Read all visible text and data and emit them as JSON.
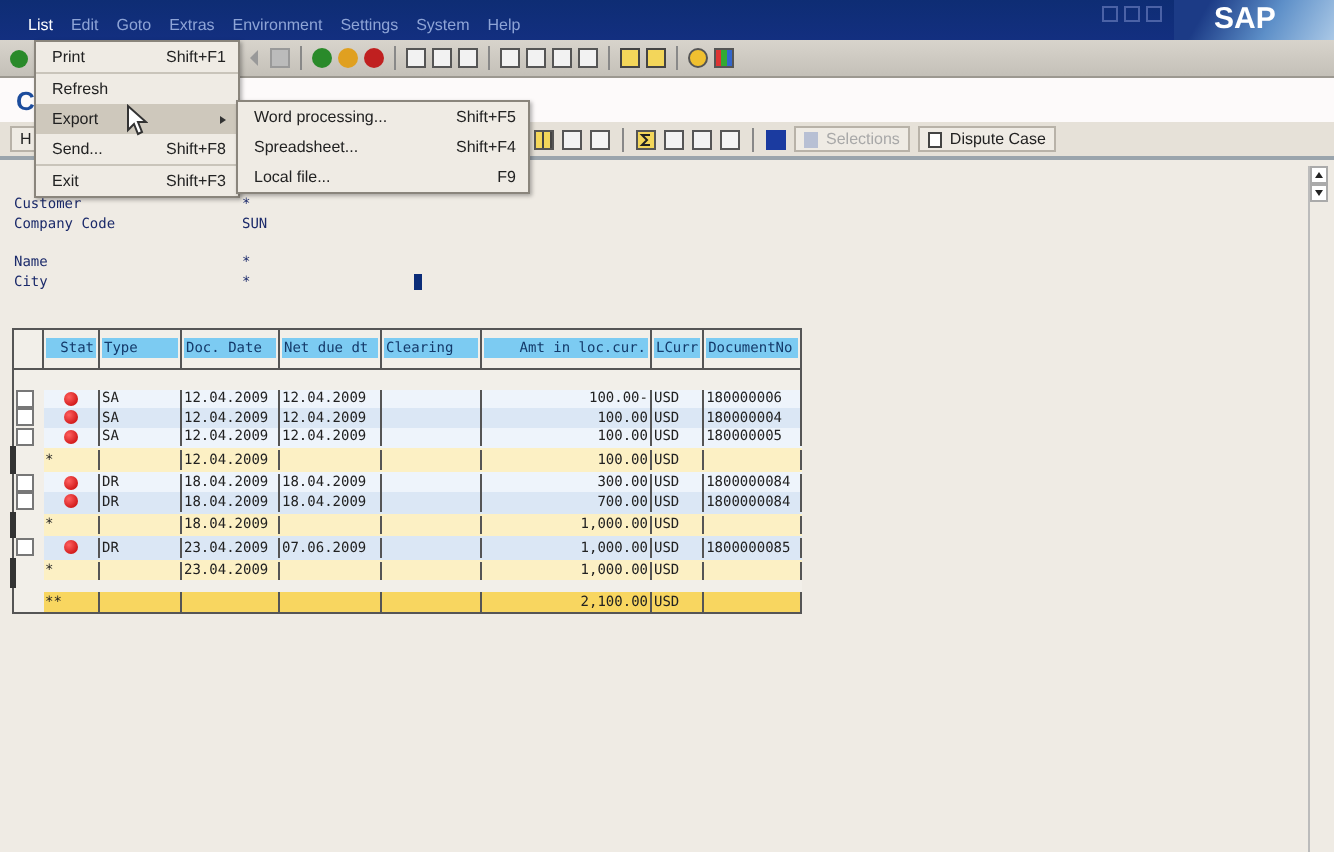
{
  "menubar": [
    {
      "label": "List",
      "selected": true
    },
    {
      "label": "Edit",
      "selected": false
    },
    {
      "label": "Goto",
      "selected": false
    },
    {
      "label": "Extras",
      "selected": false
    },
    {
      "label": "Environment",
      "selected": false
    },
    {
      "label": "Settings",
      "selected": false
    },
    {
      "label": "System",
      "selected": false
    },
    {
      "label": "Help",
      "selected": false
    }
  ],
  "logo": "SAP",
  "title": "C",
  "app_toolbar": {
    "left": "H",
    "buttons": [
      {
        "label": "Selections",
        "disabled": true
      },
      {
        "label": "Dispute Case",
        "disabled": false
      }
    ]
  },
  "list_menu": [
    {
      "label": "Print",
      "shortcut": "Shift+F1",
      "selected": false,
      "submenu": false
    },
    {
      "label": "Refresh",
      "selected": false,
      "submenu": false
    },
    {
      "label": "Export",
      "selected": true,
      "submenu": true
    },
    {
      "label": "Send...",
      "shortcut": "Shift+F8",
      "selected": false,
      "submenu": false
    },
    {
      "label": "Exit",
      "shortcut": "Shift+F3",
      "selected": false,
      "submenu": false
    }
  ],
  "export_menu": [
    {
      "label": "Word processing...",
      "shortcut": "Shift+F5"
    },
    {
      "label": "Spreadsheet...",
      "shortcut": "Shift+F4"
    },
    {
      "label": "Local file...",
      "shortcut": "F9"
    }
  ],
  "header_fields": [
    {
      "label": "Customer",
      "value": "*"
    },
    {
      "label": "Company Code",
      "value": "SUN"
    },
    {
      "label": "Name",
      "value": "*"
    },
    {
      "label": "City",
      "value": "*"
    }
  ],
  "table": {
    "columns": [
      "Stat",
      "Type",
      "Doc. Date",
      "Net due dt",
      "Clearing",
      "Amt in loc.cur.",
      "LCurr",
      "DocumentNo"
    ],
    "rows": [
      {
        "kind": "item",
        "checked": false,
        "type": "SA",
        "doc_date": "12.04.2009",
        "net_due": "12.04.2009",
        "amount": "100.00-",
        "currency": "USD",
        "doc_no": "180000006"
      },
      {
        "kind": "item",
        "checked": false,
        "type": "SA",
        "doc_date": "12.04.2009",
        "net_due": "12.04.2009",
        "amount": "100.00",
        "currency": "USD",
        "doc_no": "180000004"
      },
      {
        "kind": "item",
        "checked": false,
        "type": "SA",
        "doc_date": "12.04.2009",
        "net_due": "12.04.2009",
        "amount": "100.00",
        "currency": "USD",
        "doc_no": "180000005"
      },
      {
        "kind": "subtotal",
        "stars": "*",
        "doc_date": "12.04.2009",
        "amount": "100.00",
        "currency": "USD"
      },
      {
        "kind": "item",
        "checked": false,
        "type": "DR",
        "doc_date": "18.04.2009",
        "net_due": "18.04.2009",
        "amount": "300.00",
        "currency": "USD",
        "doc_no": "1800000084"
      },
      {
        "kind": "item",
        "checked": false,
        "type": "DR",
        "doc_date": "18.04.2009",
        "net_due": "18.04.2009",
        "amount": "700.00",
        "currency": "USD",
        "doc_no": "1800000084"
      },
      {
        "kind": "subtotal",
        "stars": "*",
        "doc_date": "18.04.2009",
        "amount": "1,000.00",
        "currency": "USD"
      },
      {
        "kind": "item",
        "checked": false,
        "type": "DR",
        "doc_date": "23.04.2009",
        "net_due": "07.06.2009",
        "amount": "1,000.00",
        "currency": "USD",
        "doc_no": "1800000085"
      },
      {
        "kind": "subtotal",
        "stars": "*",
        "doc_date": "23.04.2009",
        "amount": "1,000.00",
        "currency": "USD"
      },
      {
        "kind": "total",
        "stars": "**",
        "amount": "2,100.00",
        "currency": "USD"
      }
    ]
  }
}
